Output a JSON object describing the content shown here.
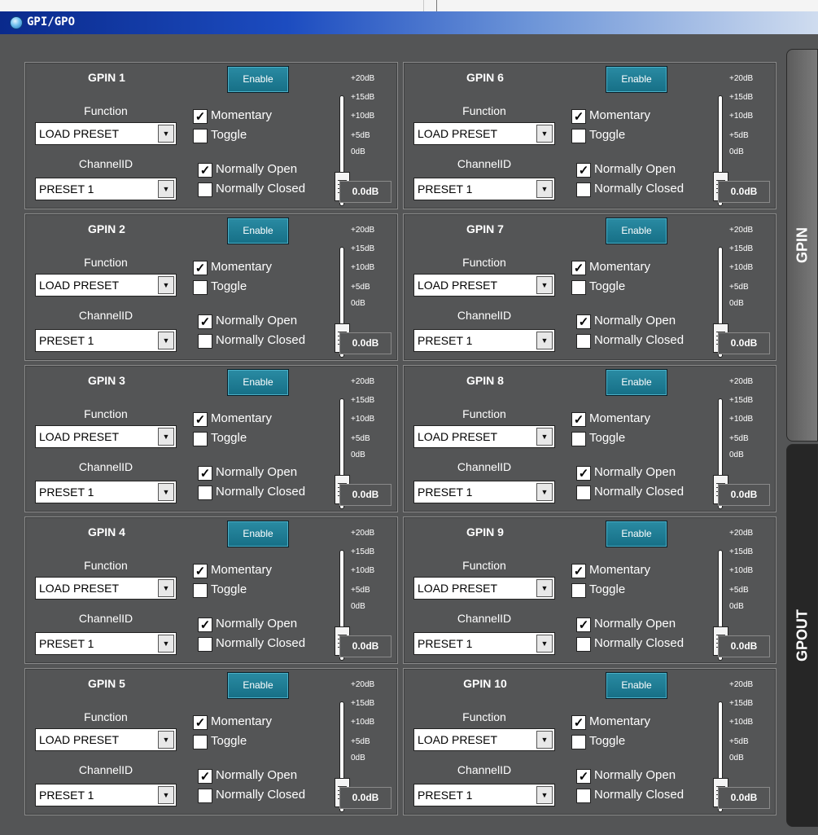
{
  "window": {
    "title": "GPI/GPO"
  },
  "tabs": {
    "gpin": "GPIN",
    "gpout": "GPOUT"
  },
  "common": {
    "enable_label": "Enable",
    "function_label": "Function",
    "channelid_label": "ChannelID",
    "function_value": "LOAD PRESET",
    "channel_value": "PRESET 1",
    "momentary_label": "Momentary",
    "toggle_label": "Toggle",
    "normally_open_label": "Normally Open",
    "normally_closed_label": "Normally Closed",
    "ticks": [
      "+20dB",
      "+15dB",
      "+10dB",
      "+5dB",
      "0dB"
    ],
    "gain": "0.0dB",
    "checked_mark": "✓"
  },
  "panels": [
    {
      "title": "GPIN 1",
      "momentary": true,
      "toggle": false,
      "normally_open": true,
      "normally_closed": false
    },
    {
      "title": "GPIN 2",
      "momentary": true,
      "toggle": false,
      "normally_open": true,
      "normally_closed": false
    },
    {
      "title": "GPIN 3",
      "momentary": true,
      "toggle": false,
      "normally_open": true,
      "normally_closed": false
    },
    {
      "title": "GPIN 4",
      "momentary": true,
      "toggle": false,
      "normally_open": true,
      "normally_closed": false
    },
    {
      "title": "GPIN 5",
      "momentary": true,
      "toggle": false,
      "normally_open": true,
      "normally_closed": false
    },
    {
      "title": "GPIN 6",
      "momentary": true,
      "toggle": false,
      "normally_open": true,
      "normally_closed": false
    },
    {
      "title": "GPIN 7",
      "momentary": true,
      "toggle": false,
      "normally_open": true,
      "normally_closed": false
    },
    {
      "title": "GPIN 8",
      "momentary": true,
      "toggle": false,
      "normally_open": true,
      "normally_closed": false
    },
    {
      "title": "GPIN 9",
      "momentary": true,
      "toggle": false,
      "normally_open": true,
      "normally_closed": false
    },
    {
      "title": "GPIN 10",
      "momentary": true,
      "toggle": false,
      "normally_open": true,
      "normally_closed": false
    }
  ]
}
